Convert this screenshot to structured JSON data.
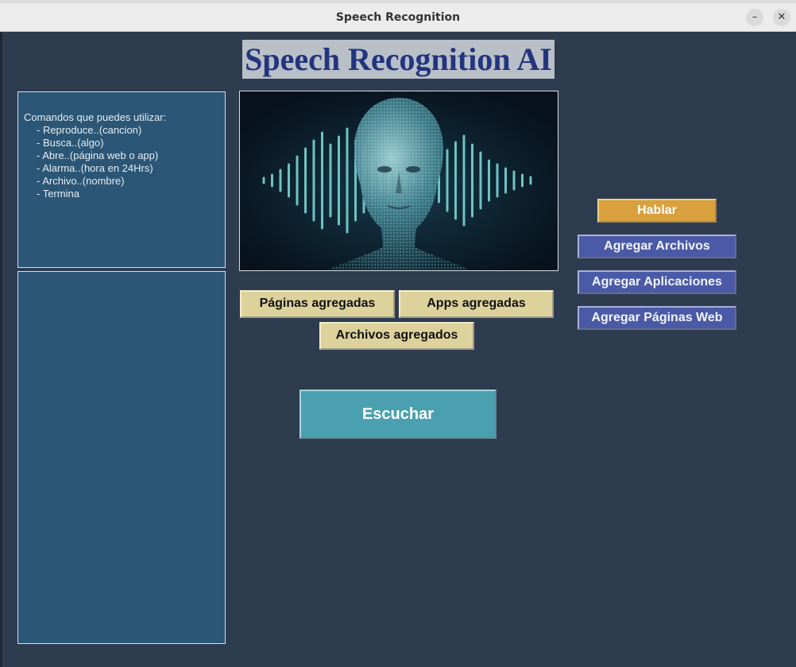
{
  "window": {
    "title": "Speech Recognition",
    "minimize_glyph": "–",
    "close_glyph": "✕"
  },
  "app": {
    "title": "Speech Recognition AI"
  },
  "commands": {
    "heading": "Comandos que puedes utilizar:",
    "items": [
      "- Reproduce..(cancion)",
      "- Busca..(algo)",
      "- Abre..(página web o app)",
      "- Alarma..(hora en 24Hrs)",
      "- Archivo..(nombre)",
      "- Termina"
    ]
  },
  "buttons": {
    "paginas_agregadas": "Páginas agregadas",
    "apps_agregadas": "Apps agregadas",
    "archivos_agregados": "Archivos agregados",
    "escuchar": "Escuchar",
    "hablar": "Hablar",
    "agregar_archivos": "Agregar Archivos",
    "agregar_aplicaciones": "Agregar Aplicaciones",
    "agregar_paginas_web": "Agregar Páginas Web"
  },
  "icons": {
    "hero_image": "ai-head-soundwave-image"
  },
  "colors": {
    "background": "#2e3c50",
    "panel": "#2b5676",
    "title_text": "#23357e",
    "button_tan": "#ddd29b",
    "button_blue": "#4a5aa6",
    "button_orange": "#d8a13e",
    "button_teal": "#4ba0af"
  }
}
